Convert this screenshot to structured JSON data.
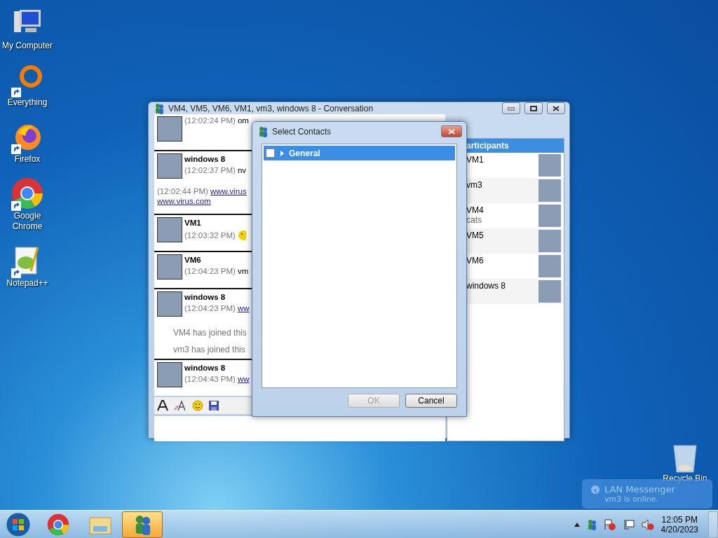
{
  "desktop_icons": [
    {
      "label": "My Computer",
      "kind": "computer",
      "shortcut": false
    },
    {
      "label": "Everything",
      "kind": "everything",
      "shortcut": true
    },
    {
      "label": "Firefox",
      "kind": "firefox",
      "shortcut": true
    },
    {
      "label": "Google Chrome",
      "kind": "chrome",
      "shortcut": true
    },
    {
      "label": "Notepad++",
      "kind": "notepad",
      "shortcut": true
    }
  ],
  "recycle_bin": {
    "label": "Recycle Bin"
  },
  "conversation": {
    "title": "VM4, VM5, VM6, VM1, vm3, windows 8 - Conversation",
    "messages": [
      {
        "kind": "message",
        "time": "(12:02:24 PM)",
        "text": "om",
        "link": false
      },
      {
        "kind": "message",
        "sender": "windows 8",
        "time": "(12:02:37 PM)",
        "text": "nv",
        "link": false
      },
      {
        "kind": "continuation",
        "time": "(12:02:44 PM)",
        "text": "www.virus",
        "link": true,
        "next_line": "www.virus.com"
      },
      {
        "kind": "message",
        "sender": "VM1",
        "time": "(12:03:32 PM)",
        "emoticon": true
      },
      {
        "kind": "message",
        "sender": "VM6",
        "time": "(12:04:23 PM)",
        "text": "vm",
        "link": false
      },
      {
        "kind": "message",
        "sender": "windows 8",
        "time": "(12:04:23 PM)",
        "text": "ww",
        "link": true
      },
      {
        "kind": "notice",
        "text": "VM4 has joined this"
      },
      {
        "kind": "notice",
        "text": "vm3 has joined this"
      },
      {
        "kind": "message",
        "sender": "windows 8",
        "time": "(12:04:43 PM)",
        "text": "ww",
        "link": true
      }
    ],
    "participants_header": "articipants",
    "participants": [
      {
        "name": "VM1"
      },
      {
        "name": "vm3"
      },
      {
        "name": "VM4",
        "status": "cats"
      },
      {
        "name": "VM5"
      },
      {
        "name": "VM6"
      },
      {
        "name": "windows 8"
      }
    ]
  },
  "select_contacts": {
    "title": "Select Contacts",
    "groups": [
      {
        "label": "General",
        "checked": false,
        "expanded": false,
        "selected": true
      }
    ],
    "buttons": [
      {
        "label": "OK",
        "disabled": true
      },
      {
        "label": "Cancel",
        "disabled": false
      }
    ]
  },
  "notification": {
    "title": "LAN Messenger",
    "text": "vm3 is online."
  },
  "taskbar": {
    "apps": [
      {
        "kind": "chrome",
        "active": false
      },
      {
        "kind": "explorer",
        "active": false
      },
      {
        "kind": "messenger",
        "active": true
      }
    ],
    "time": "12:05 PM",
    "date": "4/20/2023"
  }
}
